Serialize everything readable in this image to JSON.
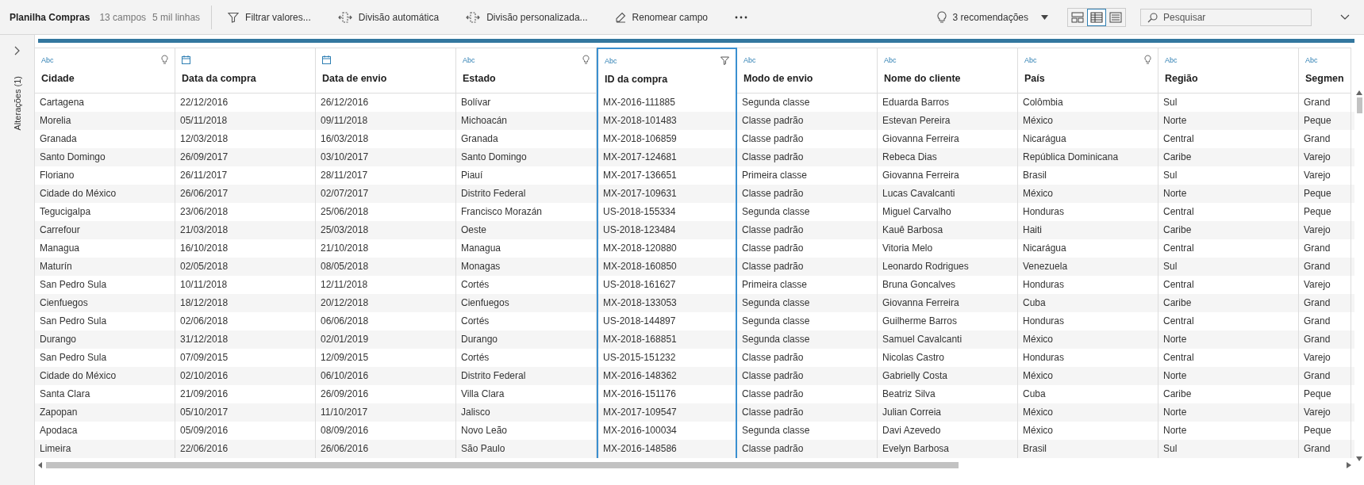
{
  "toolbar": {
    "title": "Planilha Compras",
    "fields": "13 campos",
    "rows": "5 mil linhas",
    "actions": [
      {
        "kind": "filter",
        "label": "Filtrar valores..."
      },
      {
        "kind": "split",
        "label": "Divisão automática"
      },
      {
        "kind": "split",
        "label": "Divisão personalizada..."
      },
      {
        "kind": "rename",
        "label": "Renomear campo"
      },
      {
        "kind": "more"
      }
    ],
    "recommendations": "3 recomendações",
    "views": [
      {
        "kind": "cards",
        "selected": false
      },
      {
        "kind": "table",
        "selected": true
      },
      {
        "kind": "list",
        "selected": false
      }
    ],
    "search": {
      "placeholder": "Pesquisar"
    }
  },
  "changes_panel": {
    "label": "Alterações (1)"
  },
  "table": {
    "columns": [
      {
        "name": "Cidade",
        "kind": "text",
        "type_label": "Abc",
        "recommendation": true,
        "filtered": false,
        "selected": false
      },
      {
        "name": "Data da compra",
        "kind": "date",
        "recommendation": false,
        "filtered": false,
        "selected": false
      },
      {
        "name": "Data de envio",
        "kind": "date",
        "recommendation": false,
        "filtered": false,
        "selected": false
      },
      {
        "name": "Estado",
        "kind": "text",
        "type_label": "Abc",
        "recommendation": true,
        "filtered": false,
        "selected": false
      },
      {
        "name": "ID da compra",
        "kind": "text",
        "type_label": "Abc",
        "recommendation": false,
        "filtered": true,
        "selected": true
      },
      {
        "name": "Modo de envio",
        "kind": "text",
        "type_label": "Abc",
        "recommendation": false,
        "filtered": false,
        "selected": false
      },
      {
        "name": "Nome do cliente",
        "kind": "text",
        "type_label": "Abc",
        "recommendation": false,
        "filtered": false,
        "selected": false
      },
      {
        "name": "País",
        "kind": "text",
        "type_label": "Abc",
        "recommendation": true,
        "filtered": false,
        "selected": false
      },
      {
        "name": "Região",
        "kind": "text",
        "type_label": "Abc",
        "recommendation": false,
        "filtered": false,
        "selected": false
      },
      {
        "name": "Segmen",
        "kind": "text",
        "type_label": "Abc",
        "recommendation": false,
        "filtered": false,
        "selected": false
      }
    ],
    "rows": [
      [
        "Cartagena",
        "22/12/2016",
        "26/12/2016",
        "Bolívar",
        "MX-2016-111885",
        "Segunda classe",
        "Eduarda Barros",
        "Colômbia",
        "Sul",
        "Grand"
      ],
      [
        "Morelia",
        "05/11/2018",
        "09/11/2018",
        "Michoacán",
        "MX-2018-101483",
        "Classe padrão",
        "Estevan Pereira",
        "México",
        "Norte",
        "Peque"
      ],
      [
        "Granada",
        "12/03/2018",
        "16/03/2018",
        "Granada",
        "MX-2018-106859",
        "Classe padrão",
        "Giovanna Ferreira",
        "Nicarágua",
        "Central",
        "Grand"
      ],
      [
        "Santo Domingo",
        "26/09/2017",
        "03/10/2017",
        "Santo Domingo",
        "MX-2017-124681",
        "Classe padrão",
        "Rebeca Dias",
        "República Dominicana",
        "Caribe",
        "Varejo"
      ],
      [
        "Floriano",
        "26/11/2017",
        "28/11/2017",
        "Piauí",
        "MX-2017-136651",
        "Primeira classe",
        "Giovanna Ferreira",
        "Brasil",
        "Sul",
        "Varejo"
      ],
      [
        "Cidade do México",
        "26/06/2017",
        "02/07/2017",
        "Distrito Federal",
        "MX-2017-109631",
        "Classe padrão",
        "Lucas Cavalcanti",
        "México",
        "Norte",
        "Peque"
      ],
      [
        "Tegucigalpa",
        "23/06/2018",
        "25/06/2018",
        "Francisco Morazán",
        "US-2018-155334",
        "Segunda classe",
        "Miguel Carvalho",
        "Honduras",
        "Central",
        "Peque"
      ],
      [
        "Carrefour",
        "21/03/2018",
        "25/03/2018",
        "Oeste",
        "US-2018-123484",
        "Classe padrão",
        "Kauê Barbosa",
        "Haiti",
        "Caribe",
        "Varejo"
      ],
      [
        "Managua",
        "16/10/2018",
        "21/10/2018",
        "Managua",
        "MX-2018-120880",
        "Classe padrão",
        "Vitoria Melo",
        "Nicarágua",
        "Central",
        "Grand"
      ],
      [
        "Maturín",
        "02/05/2018",
        "08/05/2018",
        "Monagas",
        "MX-2018-160850",
        "Classe padrão",
        "Leonardo Rodrigues",
        "Venezuela",
        "Sul",
        "Grand"
      ],
      [
        "San Pedro Sula",
        "10/11/2018",
        "12/11/2018",
        "Cortés",
        "US-2018-161627",
        "Primeira classe",
        "Bruna Goncalves",
        "Honduras",
        "Central",
        "Varejo"
      ],
      [
        "Cienfuegos",
        "18/12/2018",
        "20/12/2018",
        "Cienfuegos",
        "MX-2018-133053",
        "Segunda classe",
        "Giovanna Ferreira",
        "Cuba",
        "Caribe",
        "Grand"
      ],
      [
        "San Pedro Sula",
        "02/06/2018",
        "06/06/2018",
        "Cortés",
        "US-2018-144897",
        "Segunda classe",
        "Guilherme Barros",
        "Honduras",
        "Central",
        "Grand"
      ],
      [
        "Durango",
        "31/12/2018",
        "02/01/2019",
        "Durango",
        "MX-2018-168851",
        "Segunda classe",
        "Samuel Cavalcanti",
        "México",
        "Norte",
        "Grand"
      ],
      [
        "San Pedro Sula",
        "07/09/2015",
        "12/09/2015",
        "Cortés",
        "US-2015-151232",
        "Classe padrão",
        "Nicolas Castro",
        "Honduras",
        "Central",
        "Varejo"
      ],
      [
        "Cidade do México",
        "02/10/2016",
        "06/10/2016",
        "Distrito Federal",
        "MX-2016-148362",
        "Classe padrão",
        "Gabrielly Costa",
        "México",
        "Norte",
        "Grand"
      ],
      [
        "Santa Clara",
        "21/09/2016",
        "26/09/2016",
        "Villa Clara",
        "MX-2016-151176",
        "Classe padrão",
        "Beatriz Silva",
        "Cuba",
        "Caribe",
        "Peque"
      ],
      [
        "Zapopan",
        "05/10/2017",
        "11/10/2017",
        "Jalisco",
        "MX-2017-109547",
        "Classe padrão",
        "Julian Correia",
        "México",
        "Norte",
        "Varejo"
      ],
      [
        "Apodaca",
        "05/09/2016",
        "08/09/2016",
        "Novo Leão",
        "MX-2016-100034",
        "Segunda classe",
        "Davi Azevedo",
        "México",
        "Norte",
        "Peque"
      ],
      [
        "Limeira",
        "22/06/2016",
        "26/06/2016",
        "São Paulo",
        "MX-2016-148586",
        "Classe padrão",
        "Evelyn Barbosa",
        "Brasil",
        "Sul",
        "Grand"
      ]
    ]
  }
}
